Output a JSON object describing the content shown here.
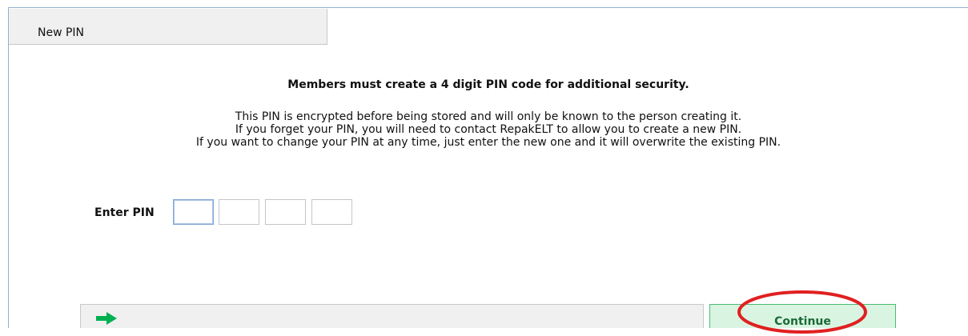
{
  "tab": {
    "title": "New PIN"
  },
  "content": {
    "headline": "Members must create a 4 digit PIN code for additional security.",
    "info_lines": [
      "This PIN is encrypted before being stored and will only be known to the person creating it.",
      "If you forget your PIN, you will need to contact RepakELT to allow you to create a new PIN.",
      "If you want to change your PIN at any time, just enter the new one and it will overwrite the existing PIN."
    ]
  },
  "pin": {
    "label": "Enter PIN",
    "digits": [
      "",
      "",
      "",
      ""
    ]
  },
  "actions": {
    "arrow_icon": "right-arrow-icon",
    "continue_label": "Continue"
  },
  "colors": {
    "arrow_green": "#00b050",
    "continue_bg": "#d9f5e2",
    "continue_border": "#4aba72",
    "highlight_red": "#e02020"
  }
}
